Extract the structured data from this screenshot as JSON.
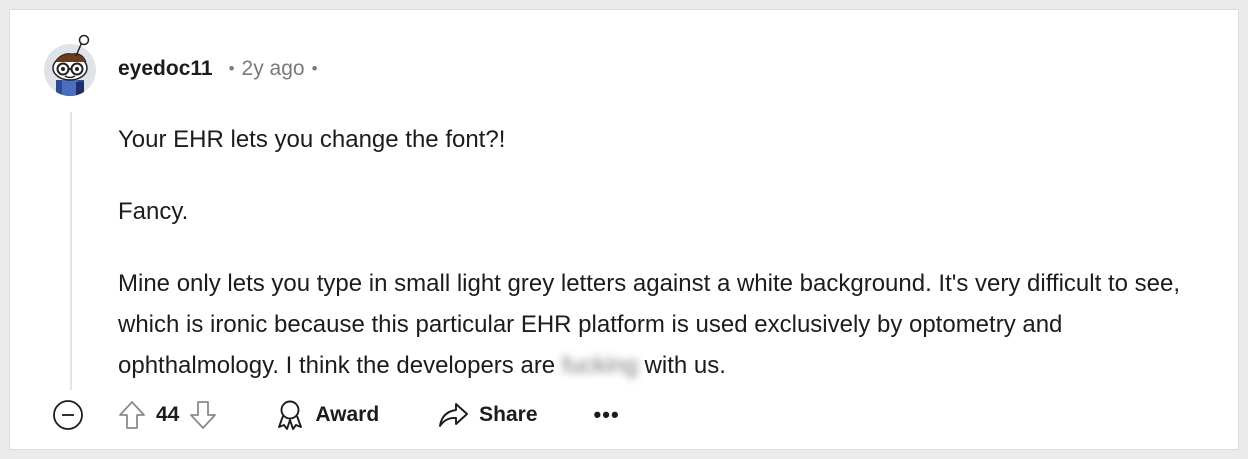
{
  "comment": {
    "author": "eyedoc11",
    "separator": "•",
    "timestamp": "2y ago",
    "paragraphs": [
      "Your EHR lets you change the font?!",
      "Fancy.",
      "Mine only lets you type in small light grey letters against a white background. It's very difficult to see, which is ironic because this particular EHR platform is used exclusively by optometry and ophthalmology. I think the developers are"
    ],
    "blurred_word": "fucking",
    "trailing_text": " with us."
  },
  "actions": {
    "score": "44",
    "award_label": "Award",
    "share_label": "Share",
    "more_label": "•••"
  },
  "icons": {
    "collapse": "minus-circle-icon",
    "upvote": "arrow-up-icon",
    "downvote": "arrow-down-icon",
    "award": "award-ribbon-icon",
    "share": "share-arrow-icon",
    "avatar": "snoo-avatar-icon"
  }
}
